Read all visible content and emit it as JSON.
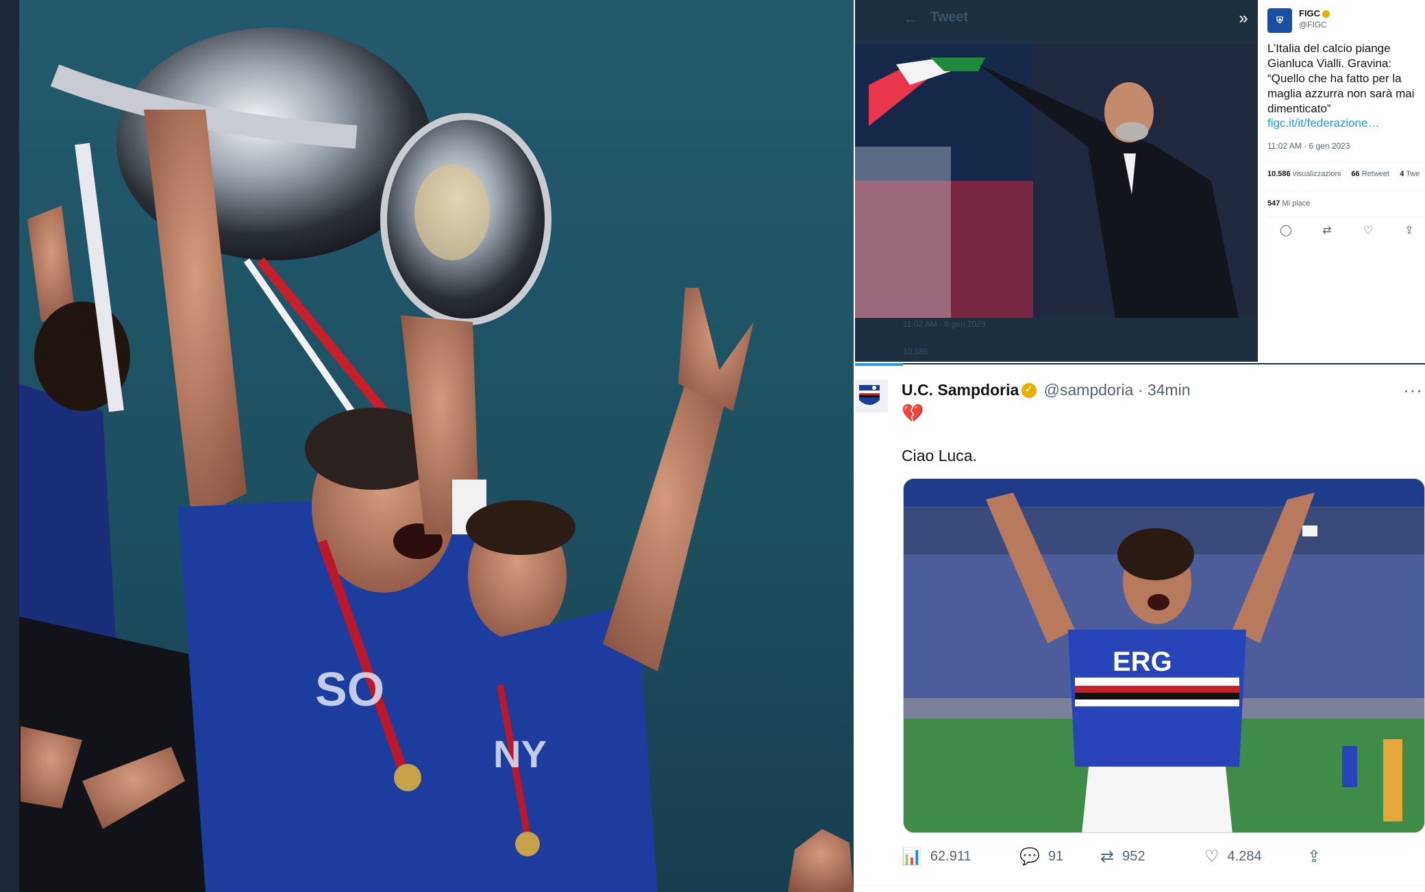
{
  "figc_tweet": {
    "nav_title": "Tweet",
    "author_name": "FIGC",
    "author_handle": "@FIGC",
    "text": "L’Italia del calcio piange Gianluca Vialli. Gravina: “Quello che ha fatto per la maglia azzurra non sarà mai dimenticato”",
    "link": "figc.it/it/federazione…",
    "time": "11:02 AM · 6 gen 2023",
    "views_count": "10.586",
    "views_label": "visualizzazioni",
    "retweets_count": "66",
    "retweets_label": "Retweet",
    "quotes_count": "4",
    "quotes_label": "Twe",
    "likes_count": "547",
    "likes_label": "Mi piace"
  },
  "samp_tweet": {
    "author_name": "U.C. Sampdoria",
    "author_handle": "@sampdoria",
    "time": "34min",
    "emoji": "💔",
    "text": "Ciao Luca.",
    "views": "62.911",
    "replies": "91",
    "retweets": "952",
    "likes": "4.284"
  },
  "icons": {
    "expand": "double-chevron-right-icon",
    "reply": "speech-bubble-icon",
    "retweet": "retweet-icon",
    "like": "heart-icon",
    "share": "share-icon",
    "views": "bar-chart-icon",
    "more": "more-icon"
  },
  "colors": {
    "twitter_blue": "#1d9bf0",
    "verified_gold": "#e8b100",
    "dark_panel": "#1e2f40"
  }
}
